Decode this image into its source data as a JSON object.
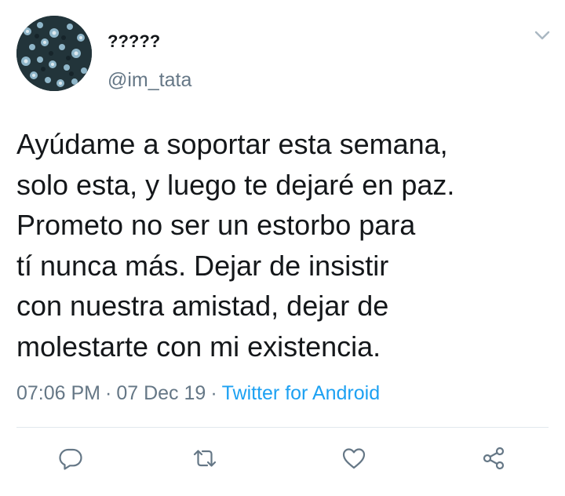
{
  "user": {
    "display_name": "?????",
    "handle": "@im_tata"
  },
  "tweet": {
    "text": "Ayúdame a soportar esta semana,\nsolo esta, y luego te dejaré en paz.\nPrometo no ser un estorbo para\ntí nunca más. Dejar de insistir\ncon nuestra amistad, dejar de\nmolestarte con mi existencia.",
    "time": "07:06 PM",
    "date": "07 Dec 19",
    "separator": "·",
    "source": "Twitter for Android"
  },
  "icons": {
    "menu": "chevron-down-icon",
    "reply": "reply-icon",
    "retweet": "retweet-icon",
    "like": "heart-icon",
    "share": "share-icon"
  },
  "colors": {
    "text": "#14171a",
    "secondary": "#657786",
    "link": "#1da1f2",
    "divider": "#e1e8ed"
  }
}
